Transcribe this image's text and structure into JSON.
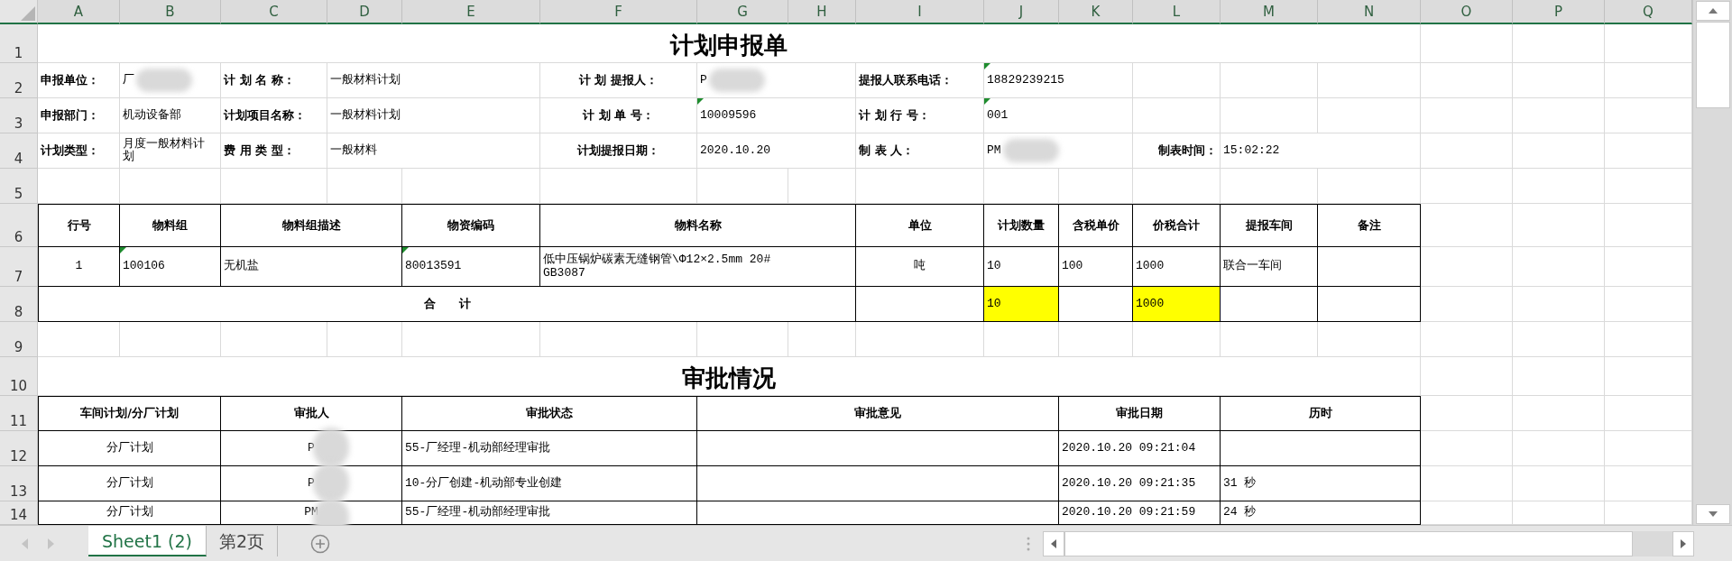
{
  "column_headers": [
    "A",
    "B",
    "C",
    "D",
    "E",
    "F",
    "G",
    "H",
    "I",
    "J",
    "K",
    "L",
    "M",
    "N",
    "O",
    "P",
    "Q"
  ],
  "row_headers": [
    "1",
    "2",
    "3",
    "4",
    "5",
    "6",
    "7",
    "8",
    "9",
    "10",
    "11",
    "12",
    "13",
    "14"
  ],
  "title": "计划申报单",
  "header_fields": [
    [
      {
        "label": "申报单位：",
        "value": "厂",
        "redacted": true
      },
      {
        "label": "计 划 名 称：",
        "value": "一般材料计划"
      },
      {
        "label": "计 划 提报人：",
        "value": "P",
        "redacted": true
      },
      {
        "label": "提报人联系电话：",
        "value": "18829239215",
        "flagged": true
      }
    ],
    [
      {
        "label": "申报部门：",
        "value": "机动设备部"
      },
      {
        "label": "计划项目名称：",
        "value": "一般材料计划"
      },
      {
        "label": "计 划 单 号：",
        "value": "10009596",
        "flagged": true
      },
      {
        "label": "计 划 行 号：",
        "value": "001",
        "flagged": true
      }
    ],
    [
      {
        "label": "计划类型：",
        "value": "月度一般材料计划"
      },
      {
        "label": "费 用 类 型：",
        "value": "一般材料"
      },
      {
        "label": "计划提报日期：",
        "value": "2020.10.20"
      },
      {
        "label": "制 表 人：",
        "value": "PM",
        "redacted": true
      },
      {
        "label": "制表时间：",
        "value": "15:02:22"
      }
    ]
  ],
  "materials": {
    "columns": [
      "行号",
      "物料组",
      "物料组描述",
      "物资编码",
      "物料名称",
      "单位",
      "计划数量",
      "含税单价",
      "价税合计",
      "提报车间",
      "备注"
    ],
    "rows": [
      [
        {
          "text": "1"
        },
        {
          "text": "100106",
          "flagged": true
        },
        {
          "text": "无机盐"
        },
        {
          "text": "80013591",
          "flagged": true
        },
        {
          "text": "低中压锅炉碳素无缝钢管\\Φ12×2.5mm 20# GB3087"
        },
        {
          "text": "吨"
        },
        {
          "text": "10"
        },
        {
          "text": "100"
        },
        {
          "text": "1000"
        },
        {
          "text": "联合一车间"
        },
        {}
      ]
    ],
    "total": {
      "label": "合　　计",
      "quantity": {
        "text": "10",
        "highlighted": true
      },
      "amount": {
        "text": "1000",
        "highlighted": true
      }
    }
  },
  "approval_title": "审批情况",
  "approvals": {
    "columns": [
      "车间计划/分厂计划",
      "审批人",
      "审批状态",
      "审批意见",
      "审批日期",
      "历时"
    ],
    "rows": [
      {
        "plan": "分厂计划",
        "approver": "P",
        "redacted": true,
        "status": "55-厂经理-机动部经理审批",
        "date": "2020.10.20 09:21:04"
      },
      {
        "plan": "分厂计划",
        "approver": "P",
        "redacted": true,
        "status": "10-分厂创建-机动部专业创建",
        "date": "2020.10.20 09:21:35",
        "duration": "31 秒"
      },
      {
        "plan": "分厂计划",
        "approver": "PM",
        "redacted": true,
        "status": "55-厂经理-机动部经理审批",
        "date": "2020.10.20 09:21:59",
        "duration": "24 秒"
      }
    ]
  },
  "sheet_tabs": [
    {
      "label": "Sheet1 (2)",
      "selected": true
    },
    {
      "label": "第2页",
      "selected": false
    }
  ]
}
